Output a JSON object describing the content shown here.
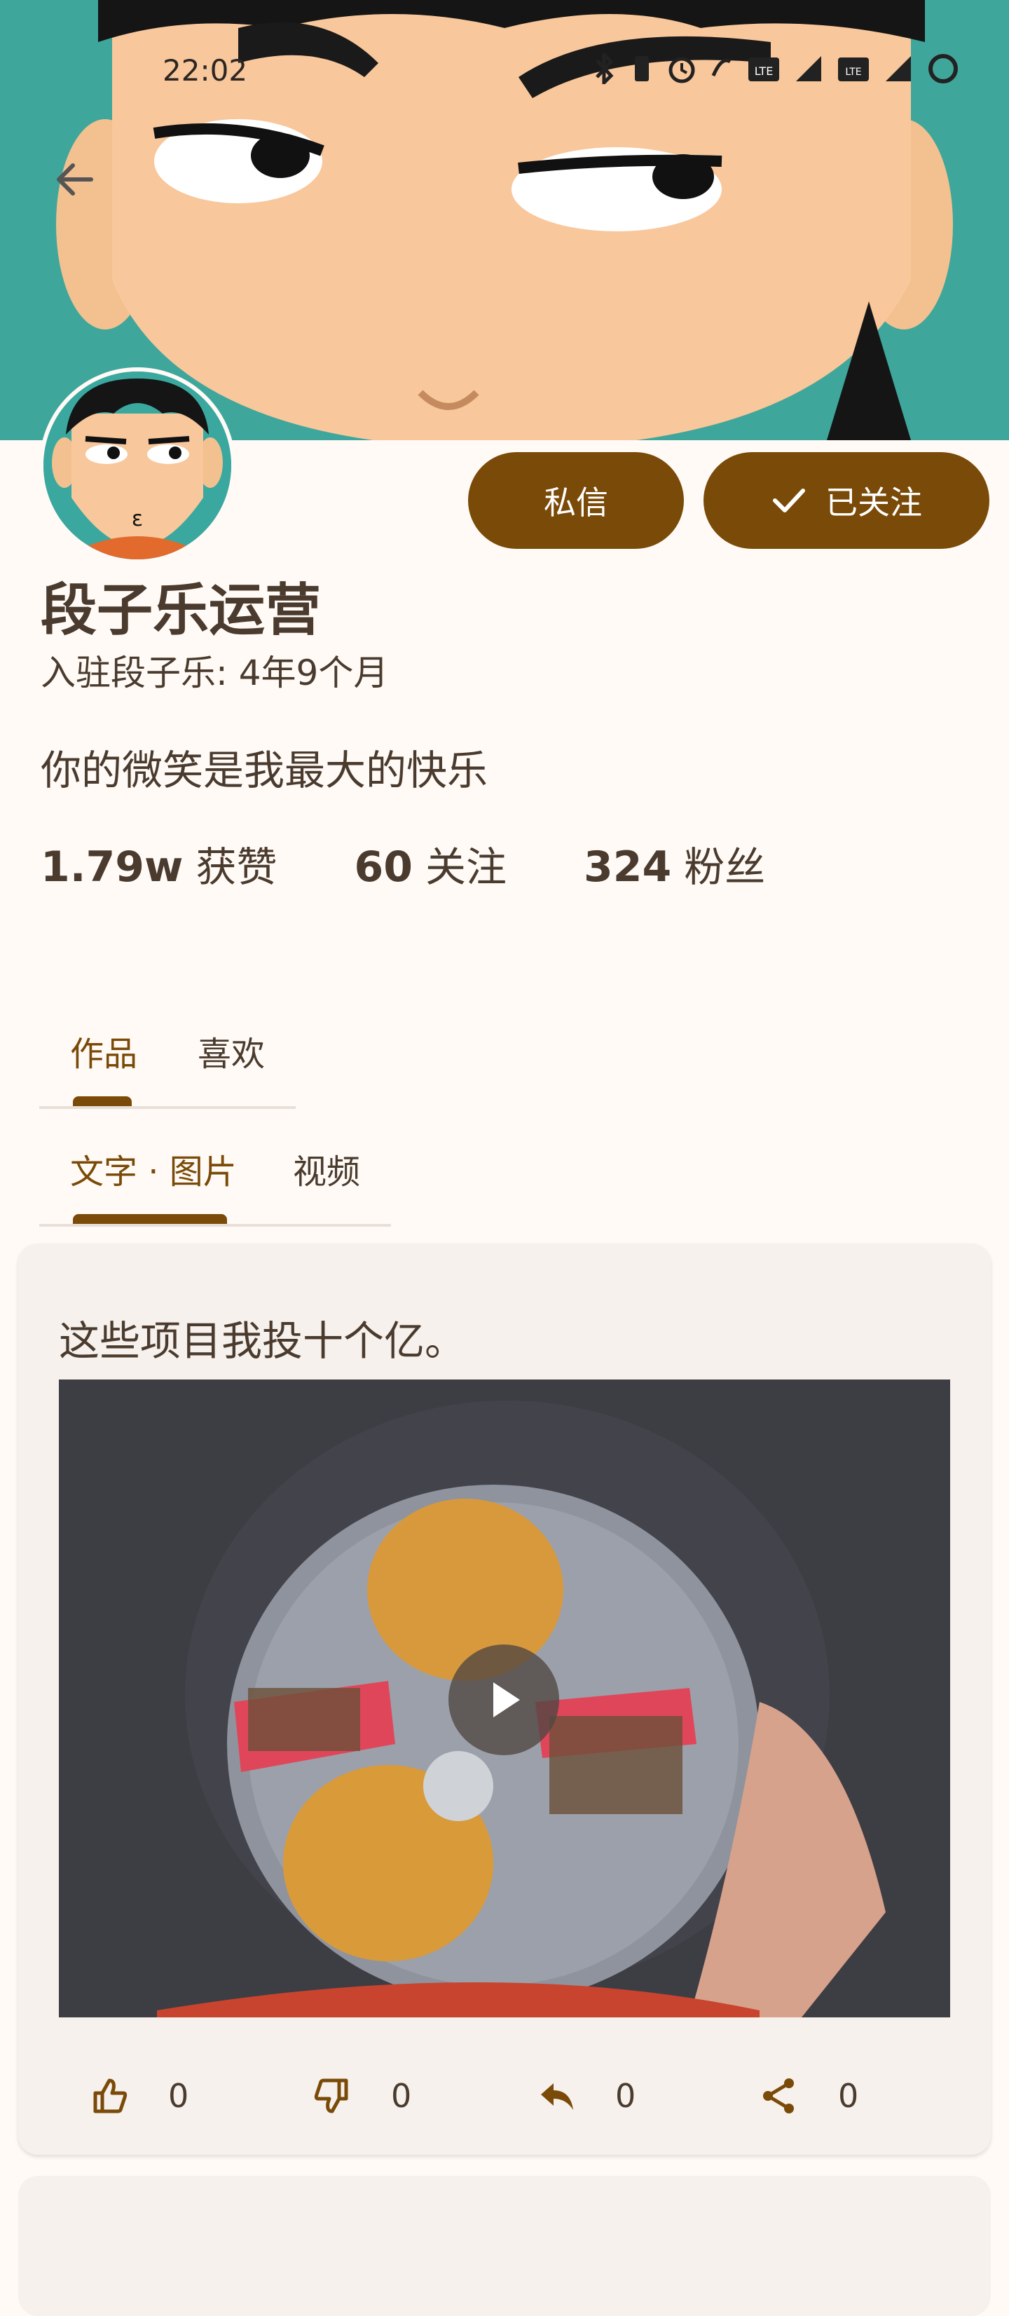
{
  "status_bar": {
    "time": "22:02",
    "icons": [
      "bluetooth-icon",
      "vibrate-icon",
      "alarm-icon",
      "nfc-icon",
      "lte-icon",
      "signal-icon",
      "volte-icon",
      "signal-icon-2",
      "loading-ring-icon"
    ]
  },
  "header": {
    "back_icon": "arrow-left-icon"
  },
  "profile": {
    "name": "段子乐运营",
    "joined": "入驻段子乐: 4年9个月",
    "bio": "你的微笑是我最大的快乐",
    "message_button": "私信",
    "follow_button": "已关注",
    "stats": [
      {
        "value": "1.79w",
        "label": "获赞"
      },
      {
        "value": "60",
        "label": "关注"
      },
      {
        "value": "324",
        "label": "粉丝"
      }
    ]
  },
  "tabs_main": [
    {
      "label": "作品",
      "active": true
    },
    {
      "label": "喜欢",
      "active": false
    }
  ],
  "tabs_sub": [
    {
      "label": "文字 · 图片",
      "active": true
    },
    {
      "label": "视频",
      "active": false
    }
  ],
  "post": {
    "text": "这些项目我投十个亿。",
    "actions": [
      {
        "icon": "thumbs-up-icon",
        "count": "0"
      },
      {
        "icon": "thumbs-down-icon",
        "count": "0"
      },
      {
        "icon": "reply-icon",
        "count": "0"
      },
      {
        "icon": "share-icon",
        "count": "0"
      }
    ]
  },
  "colors": {
    "accent": "#7a4a08",
    "background": "#fffaf6",
    "card": "#f6f1ec",
    "text": "#4a3b2e",
    "cover": "#3fa69c"
  }
}
